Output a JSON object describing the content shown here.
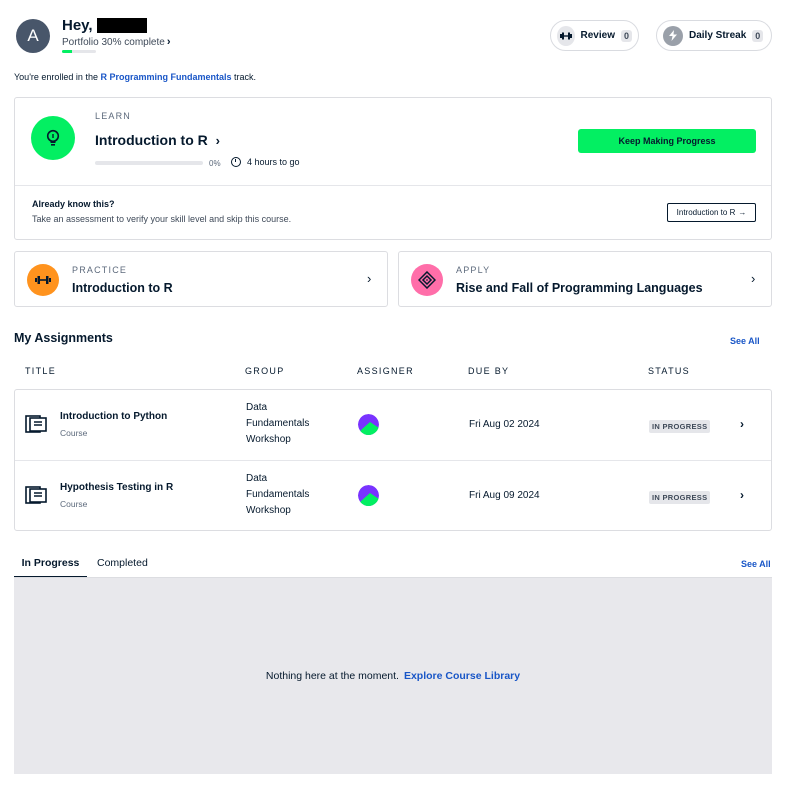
{
  "header": {
    "avatar_letter": "A",
    "greeting": "Hey,",
    "portfolio": "Portfolio 30% complete",
    "portfolio_progress": 0.3,
    "review": {
      "label": "Review",
      "count": "0"
    },
    "streak": {
      "label": "Daily Streak",
      "count": "0"
    }
  },
  "enrolled": {
    "prefix": "You're enrolled in the",
    "track": "R Programming Fundamentals",
    "suffix": "track."
  },
  "learn": {
    "eyebrow": "LEARN",
    "title": "Introduction to R",
    "progress_label": "0%",
    "progress": 0,
    "time": "4 hours to go",
    "cta": "Keep Making Progress",
    "know_title": "Already know this?",
    "know_sub": "Take an assessment to verify your skill level and skip this course.",
    "assess_button": "Introduction to R"
  },
  "practice": {
    "eyebrow": "PRACTICE",
    "title": "Introduction to R"
  },
  "apply": {
    "eyebrow": "APPLY",
    "title": "Rise and Fall of Programming Languages"
  },
  "assignments": {
    "heading": "My Assignments",
    "see_all": "See All",
    "columns": [
      "TITLE",
      "GROUP",
      "ASSIGNER",
      "DUE BY",
      "STATUS"
    ],
    "rows": [
      {
        "title": "Introduction to Python",
        "type": "Course",
        "group": [
          "Data",
          "Fundamentals",
          "Workshop"
        ],
        "due": "Fri Aug 02 2024",
        "status": "IN PROGRESS"
      },
      {
        "title": "Hypothesis Testing in R",
        "type": "Course",
        "group": [
          "Data",
          "Fundamentals",
          "Workshop"
        ],
        "due": "Fri Aug 09 2024",
        "status": "IN PROGRESS"
      }
    ]
  },
  "tabs": {
    "items": [
      "In Progress",
      "Completed"
    ],
    "see_all": "See All",
    "empty_text": "Nothing here at the moment.",
    "empty_link": "Explore Course Library"
  },
  "colors": {
    "brand_green": "#03ef62",
    "link_blue": "#1956c7",
    "navy": "#05192d",
    "practice_orange": "#ff931e",
    "apply_pink": "#ff6ea9"
  }
}
